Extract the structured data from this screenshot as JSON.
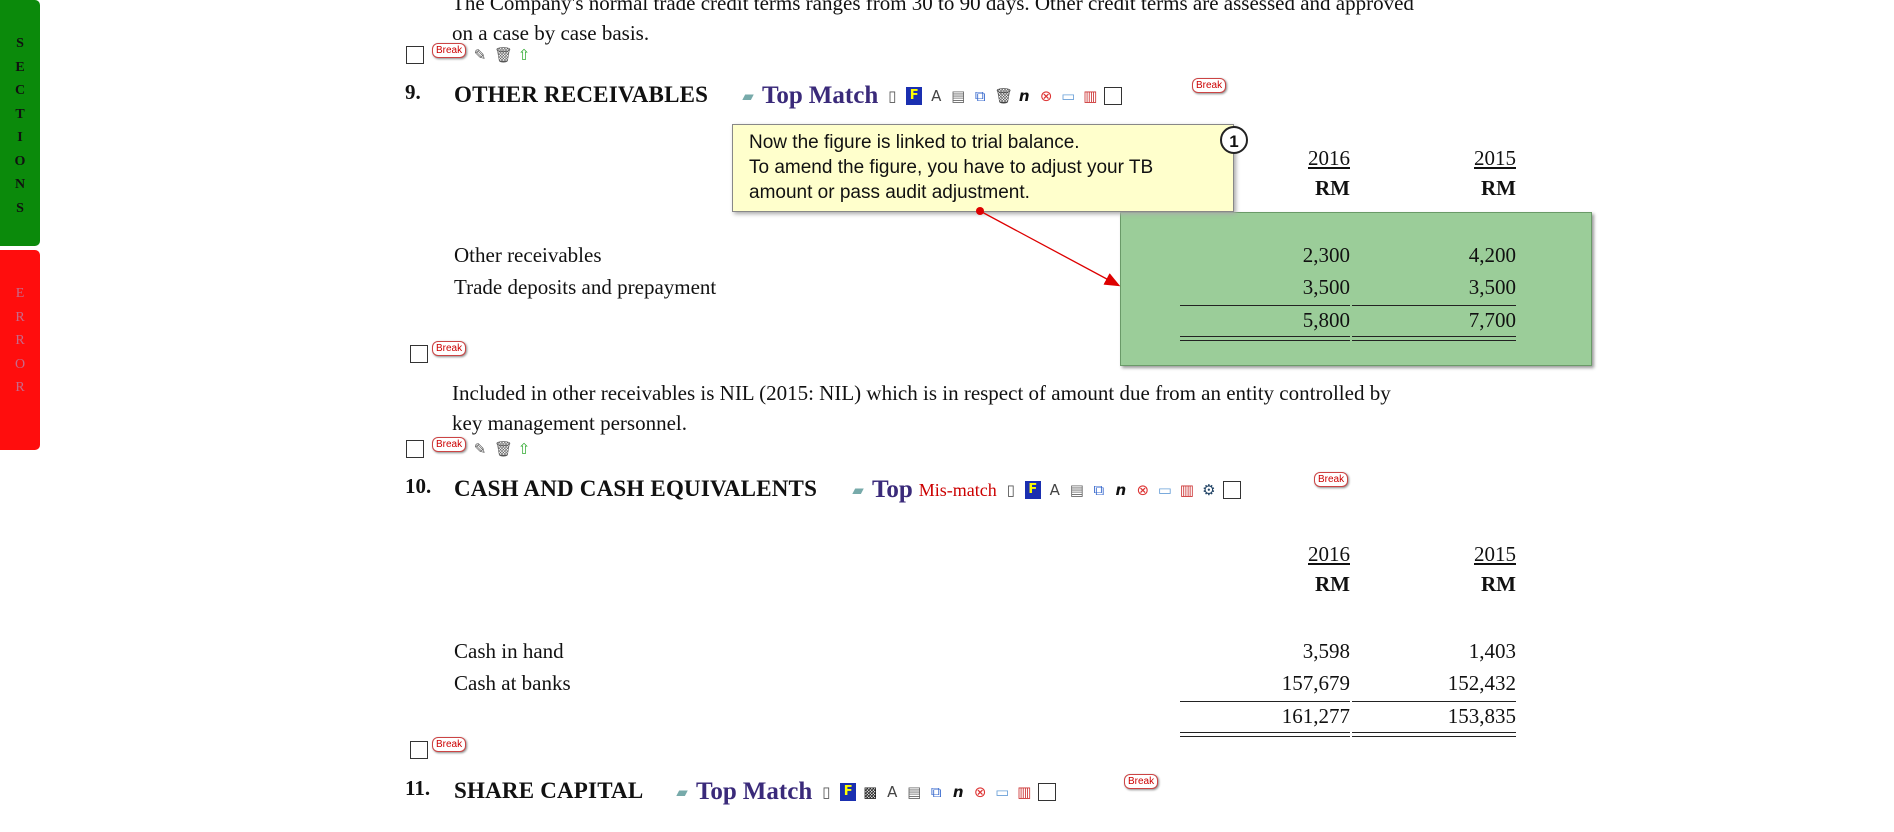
{
  "sidebar": {
    "sections_letters": [
      "S",
      "E",
      "C",
      "T",
      "I",
      "O",
      "N",
      "S"
    ],
    "error_letters": [
      "E",
      "R",
      "R",
      "O",
      "R"
    ],
    "sections_color": "#0b8a0b",
    "error_color": "#ff0d0d"
  },
  "top_paragraph": {
    "line1": "The Company's normal trade credit terms ranges from 30 to 90 days. Other credit terms are assessed and approved",
    "line2": "on a case by case basis."
  },
  "break_label": "Break",
  "notes": [
    {
      "number": "9.",
      "title": "OTHER RECEIVABLES",
      "top_label": "Top",
      "status_label": "Match",
      "years": [
        "2016",
        "2015"
      ],
      "units": [
        "RM",
        "RM"
      ],
      "rows": [
        {
          "label": "Other receivables",
          "v2016": "2,300",
          "v2015": "4,200"
        },
        {
          "label": "Trade deposits and prepayment",
          "v2016": "3,500",
          "v2015": "3,500"
        }
      ],
      "total": {
        "v2016": "5,800",
        "v2015": "7,700"
      },
      "paragraph_line1": "Included in other receivables is NIL (2015: NIL) which is in respect of amount due from an entity controlled by",
      "paragraph_line2": "key management personnel."
    },
    {
      "number": "10.",
      "title": "CASH AND CASH EQUIVALENTS",
      "top_label": "Top",
      "status_label": "Mis-match",
      "years": [
        "2016",
        "2015"
      ],
      "units": [
        "RM",
        "RM"
      ],
      "rows": [
        {
          "label": "Cash in hand",
          "v2016": "3,598",
          "v2015": "1,403"
        },
        {
          "label": "Cash at banks",
          "v2016": "157,679",
          "v2015": "152,432"
        }
      ],
      "total": {
        "v2016": "161,277",
        "v2015": "153,835"
      }
    },
    {
      "number": "11.",
      "title": "SHARE CAPITAL",
      "top_label": "Top",
      "status_label": "Match"
    }
  ],
  "tooltip": {
    "line1": "Now the figure is linked to trial balance.",
    "line2": "To amend the figure, you have to adjust your TB",
    "line3": "amount or pass audit adjustment.",
    "badge": "1"
  },
  "colors": {
    "highlight_green": "#9bcd99",
    "tooltip_yellow": "#ffffcc",
    "match_purple": "#3a2a7a",
    "mismatch_red": "#cc0000"
  }
}
